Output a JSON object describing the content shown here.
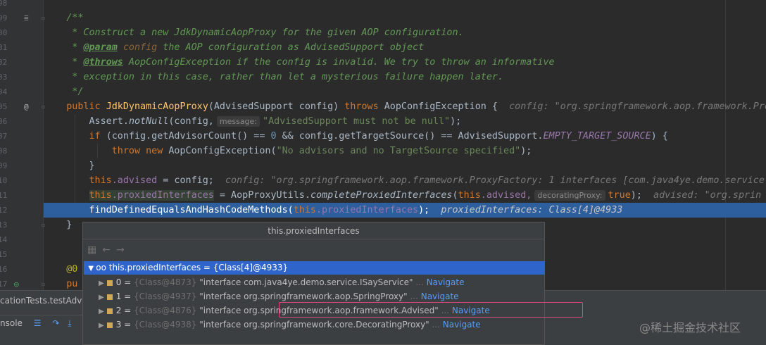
{
  "gutter": {
    "lines": [
      "98",
      "99",
      "00",
      "01",
      "02",
      "03",
      "04",
      "05",
      "06",
      "07",
      "08",
      "09",
      "10",
      "11",
      "12",
      "13",
      "14",
      "15",
      "16",
      "17"
    ]
  },
  "code": {
    "l1_indent": "    ",
    "doc_open": "/**",
    "doc_line1": " * Construct a new JdkDynamicAopProxy for the given AOP configuration.",
    "doc_line2_star": " * ",
    "doc_param_tag": "@param",
    "doc_param_name": " config",
    "doc_param_text": " the AOP configuration as AdvisedSupport object",
    "doc_line3_star": " * ",
    "doc_throws_tag": "@throws",
    "doc_throws_text": " AopConfigException if the config is invalid. We try to throw an informative",
    "doc_line4": " * exception in this case, rather than let a mysterious failure happen later.",
    "doc_close": " */",
    "ctor_public": "public ",
    "ctor_name": "JdkDynamicAopProxy",
    "ctor_params": "(AdvisedSupport config) ",
    "ctor_throws": "throws ",
    "ctor_exc": "AopConfigException {  ",
    "ctor_hint": "config: \"org.springframework.aop.framework.Pro",
    "assert_cls": "Assert.",
    "assert_fn": "notNull",
    "assert_args": "(config,",
    "assert_ph": "message:",
    "assert_str": "\"AdvisedSupport must not be null\"",
    "assert_end": ");",
    "if_kw": "if ",
    "if_a": "(config.getAdvisorCount() == ",
    "if_num": "0",
    "if_b": " && config.getTargetSource() == AdvisedSupport.",
    "if_sf": "EMPTY_TARGET_SOURCE",
    "if_end": ") {",
    "throw_kw": "throw new ",
    "throw_cls": "AopConfigException(",
    "throw_str": "\"No advisors and no TargetSource specified\"",
    "throw_end": ");",
    "close_brace": "}",
    "this_kw": "this",
    "advised_fld": ".advised",
    "adv_assign": " = config;  ",
    "adv_hint": "config: \"org.springframework.aop.framework.ProxyFactory: 1 interfaces [com.java4ye.demo.service.",
    "pi_fld": ".proxiedInterfaces",
    "pi_assign": " = AopProxyUtils.",
    "pi_fn": "completeProxiedInterfaces",
    "pi_args1": "(",
    "pi_args2": ".advised,",
    "pi_ph": "decoratingProxy:",
    "pi_true": "true",
    "pi_end": ");  ",
    "pi_hint": "advised: \"org.sprin",
    "find_call": "findDefinedEqualsAndHashCodeMethods(",
    "find_fld": ".proxiedInterfaces",
    "find_end": ");  ",
    "find_hint": "proxiedInterfaces: Class[4]@4933",
    "outer_close": "}",
    "ann_line": "@0",
    "pub_line": "pu"
  },
  "popup": {
    "title": "this.proxiedInterfaces",
    "root_label": "this.proxiedInterfaces = {Class[4]@4933}",
    "rows": [
      {
        "idx": "0",
        "ref": "{Class@4873}",
        "value": "\"interface com.java4ye.demo.service.ISayService\"",
        "nav": "Navigate"
      },
      {
        "idx": "1",
        "ref": "{Class@4937}",
        "value": "\"interface org.springframework.aop.SpringProxy\"",
        "nav": "Navigate"
      },
      {
        "idx": "2",
        "ref": "{Class@4876}",
        "value": "\"interface org.springframework.aop.framework.Advised\"",
        "nav": "Navigate"
      },
      {
        "idx": "3",
        "ref": "{Class@4938}",
        "value": "\"interface org.springframework.core.DecoratingProxy\"",
        "nav": "Navigate"
      }
    ]
  },
  "bottom": {
    "tab_label": "cationTests.testAdvis",
    "console_label": "nsole"
  },
  "watermark": "@稀土掘金技术社区",
  "colors": {
    "selection": "#2d5f9e",
    "popup_selected": "#2f65ca",
    "highlight_box": "#e0487a"
  }
}
